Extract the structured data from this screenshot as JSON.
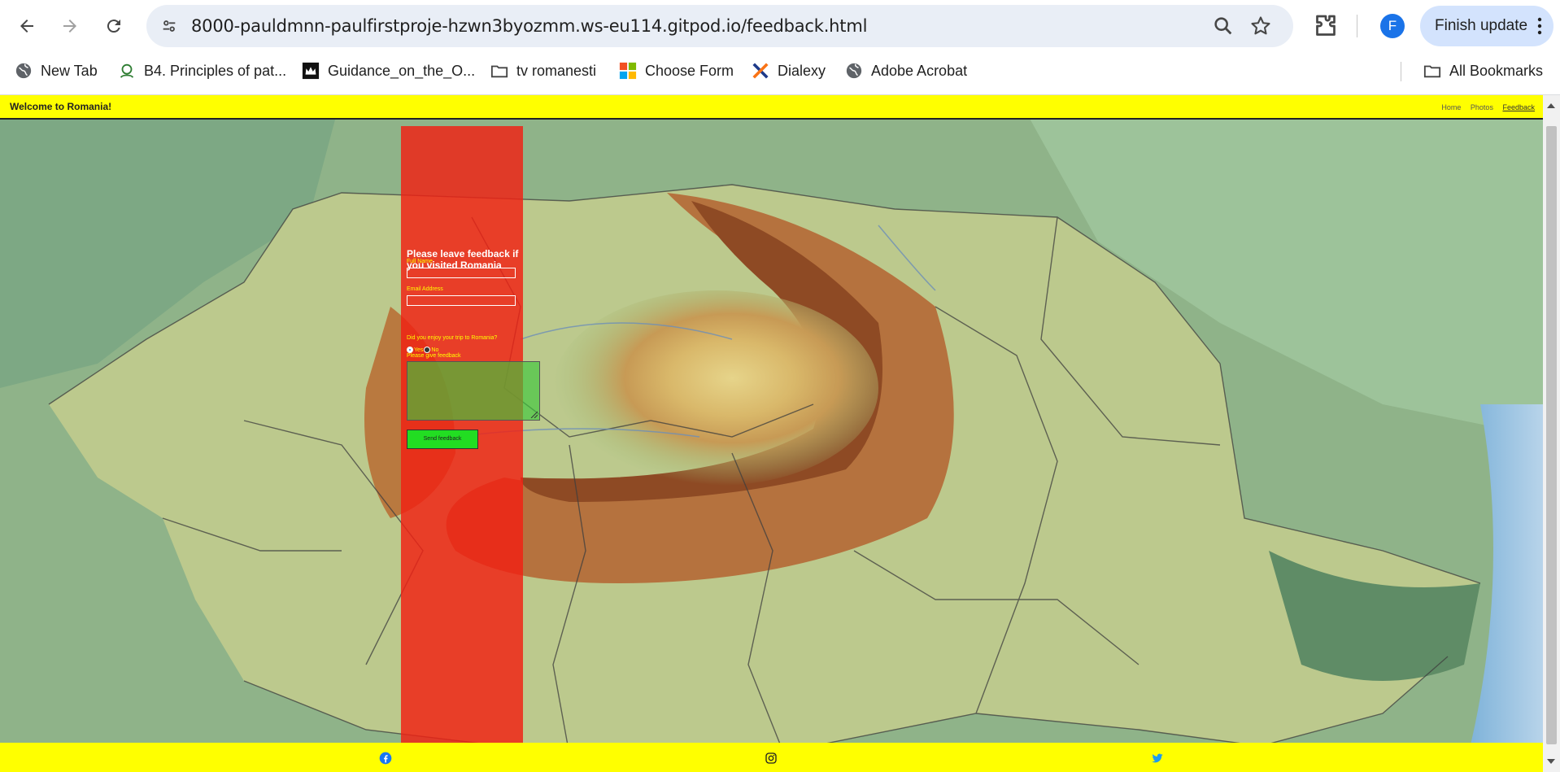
{
  "browser": {
    "url": "8000-pauldmnn-paulfirstproje-hzwn3byozmm.ws-eu114.gitpod.io/feedback.html",
    "profile_initial": "F",
    "finish_update_label": "Finish update",
    "icons": {
      "back": "back-arrow-icon",
      "forward": "forward-arrow-icon",
      "reload": "reload-icon",
      "site_info": "tune-icon",
      "zoom": "zoom-icon",
      "bookmark": "star-icon",
      "extensions": "puzzle-icon",
      "menu": "more-vert-icon"
    },
    "bookmarks": [
      {
        "label": "New Tab",
        "icon": "globe-icon"
      },
      {
        "label": "B4. Principles of pat...",
        "icon": "app-icon"
      },
      {
        "label": "Guidance_on_the_O...",
        "icon": "crown-icon"
      },
      {
        "label": "tv romanesti",
        "icon": "folder-icon"
      },
      {
        "label": "Choose Form",
        "icon": "microsoft-icon"
      },
      {
        "label": "Dialexy",
        "icon": "dialexy-icon"
      },
      {
        "label": "Adobe Acrobat",
        "icon": "globe-icon"
      }
    ],
    "all_bookmarks_label": "All Bookmarks"
  },
  "page": {
    "header": {
      "title": "Welcome to Romania!",
      "nav": [
        "Home",
        "Photos",
        "Feedback"
      ],
      "active_nav": "Feedback"
    },
    "form": {
      "heading": "Please leave feedback if you visited Romania",
      "full_name_label": "Full Name",
      "email_label": "Email Address",
      "question": "Did you enjoy your trip to Romania?",
      "yes_label": "Yes",
      "no_label": "No",
      "feedback_label": "Please give feedback",
      "submit_label": "Send feedback"
    },
    "footer": {
      "icons": [
        "facebook-icon",
        "instagram-icon",
        "twitter-icon"
      ]
    },
    "colors": {
      "header_bg": "#ffff00",
      "panel_bg": "#f22012",
      "submit_bg": "#22dd22"
    }
  }
}
